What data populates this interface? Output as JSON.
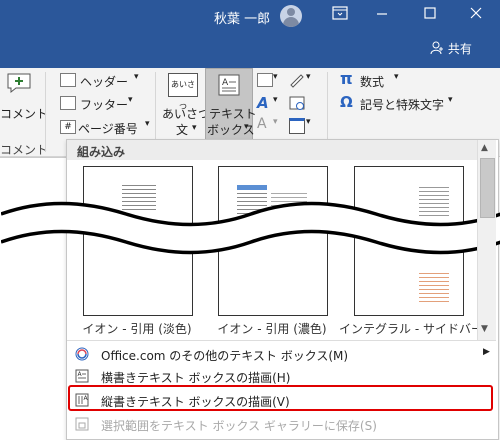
{
  "titlebar": {
    "user_name": "秋葉 一郎",
    "share_label": "共有",
    "bg_color": "#2b579a"
  },
  "ribbon": {
    "comment_label": "コメント",
    "comment_label2": "コメント",
    "header_label": "ヘッダー",
    "footer_label": "フッター",
    "page_number_label": "ページ番号",
    "greeting_label": "あいさつ",
    "greeting_label2": "文",
    "greeting_icon_text": "あいさつ",
    "textbox_label": "テキスト",
    "textbox_label2": "ボックス",
    "equation_label": "数式",
    "symbols_label": "記号と特殊文字",
    "pi_glyph": "π",
    "omega_glyph": "Ω"
  },
  "gallery": {
    "section_title": "組み込み",
    "items": [
      {
        "caption": "イオン - 引用 (淡色)"
      },
      {
        "caption": "イオン - 引用 (濃色)"
      },
      {
        "caption": "インテグラル - サイドバー"
      }
    ]
  },
  "menu": {
    "items": [
      {
        "label": "Office.com のその他のテキスト ボックス(M)",
        "icon": "office-icon",
        "disabled": false
      },
      {
        "label": "横書きテキスト ボックスの描画(H)",
        "icon": "horizontal-textbox-icon",
        "disabled": false
      },
      {
        "label": "縦書きテキスト ボックスの描画(V)",
        "icon": "vertical-textbox-icon",
        "disabled": false
      },
      {
        "label": "選択範囲をテキスト ボックス ギャラリーに保存(S)",
        "icon": "save-selection-icon",
        "disabled": true
      }
    ]
  },
  "highlight_color": "#e00000"
}
